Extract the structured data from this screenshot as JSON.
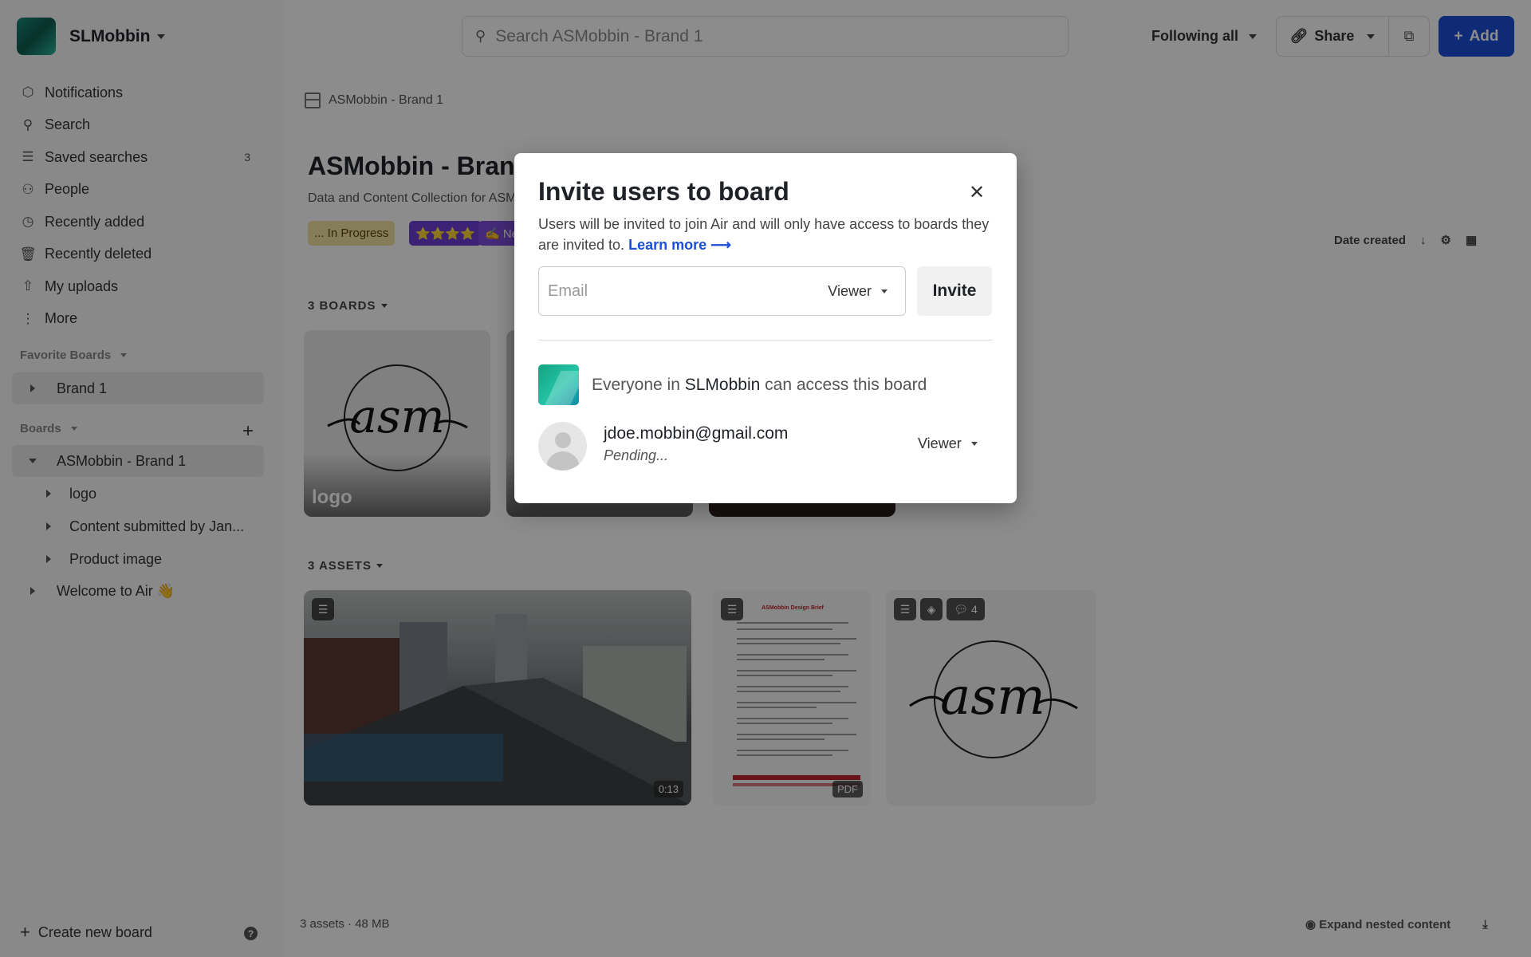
{
  "workspace": {
    "name": "SLMobbin"
  },
  "sidebar": {
    "nav": [
      {
        "label": "Notifications",
        "icon": "tag-icon"
      },
      {
        "label": "Search",
        "icon": "search-icon"
      },
      {
        "label": "Saved searches",
        "icon": "saved-searches-icon",
        "badge": "3"
      },
      {
        "label": "People",
        "icon": "people-icon"
      },
      {
        "label": "Recently added",
        "icon": "clock-icon"
      },
      {
        "label": "Recently deleted",
        "icon": "trash-icon"
      },
      {
        "label": "My uploads",
        "icon": "upload-icon"
      },
      {
        "label": "More",
        "icon": "more-icon"
      }
    ],
    "favorites_header": "Favorite Boards",
    "favorites": [
      {
        "label": "Brand 1"
      }
    ],
    "boards_header": "Boards",
    "boards": [
      {
        "label": "ASMobbin - Brand 1"
      },
      {
        "label": "logo"
      },
      {
        "label": "Content submitted by Jan..."
      },
      {
        "label": "Product image"
      },
      {
        "label": "Welcome to Air 👋"
      }
    ],
    "create_board": "Create new board"
  },
  "topbar": {
    "search_placeholder": "Search ASMobbin - Brand 1",
    "following": "Following all",
    "share": "Share",
    "add": "Add"
  },
  "main": {
    "breadcrumb": "ASMobbin - Brand 1",
    "title": "ASMobbin - Brand",
    "description": "Data and Content Collection for ASM",
    "tags": [
      {
        "label": "... In Progress",
        "bg": "#f3e3a3",
        "color": "#5a4a00"
      },
      {
        "label": "⭐⭐⭐⭐",
        "bg": "#6d3fd6",
        "color": "#fff"
      },
      {
        "label": "✍️ Ne",
        "bg": "#7c4ddb",
        "color": "#fff"
      }
    ],
    "sort_label": "Date created",
    "boards_section": "3 BOARDS",
    "boards": [
      {
        "label": "logo"
      },
      {
        "label": ""
      },
      {
        "label": ""
      }
    ],
    "assets_section": "3 ASSETS",
    "assets": [
      {
        "type": "video",
        "duration": "0:13"
      },
      {
        "type": "pdf",
        "badge": "PDF",
        "doc_title": "ASMobbin Design Brief"
      },
      {
        "type": "image",
        "comments": "4"
      }
    ],
    "footer_stats": "3 assets · 48 MB",
    "expand_nested": "Expand nested content"
  },
  "modal": {
    "title": "Invite users to board",
    "description": "Users will be invited to join Air and will only have access to boards they are invited to.",
    "learn_more": "Learn more ⟶",
    "email_placeholder": "Email",
    "role": "Viewer",
    "invite_button": "Invite",
    "everyone_prefix": "Everyone in",
    "everyone_workspace": "SLMobbin",
    "everyone_suffix": "can access this board",
    "users": [
      {
        "email": "jdoe.mobbin@gmail.com",
        "status": "Pending...",
        "role": "Viewer"
      }
    ]
  },
  "colors": {
    "accent": "#1d4ed8",
    "overlay": "rgba(0,0,0,0.45)"
  }
}
